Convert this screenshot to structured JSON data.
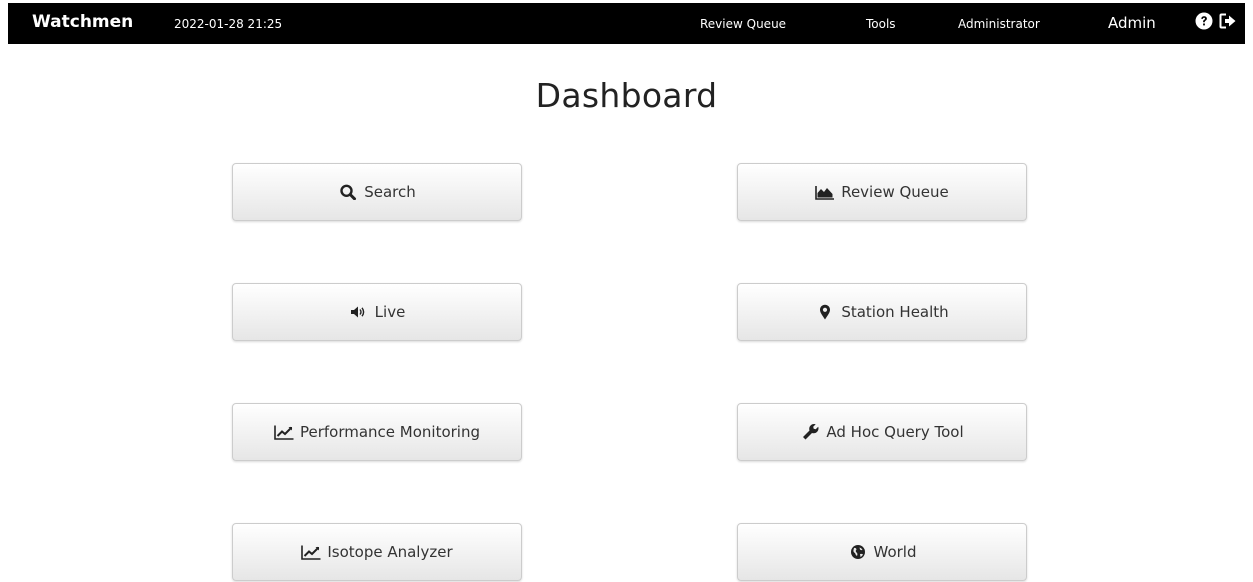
{
  "navbar": {
    "brand": "Watchmen",
    "datetime": "2022-01-28 21:25",
    "links": [
      {
        "label": "Review Queue"
      },
      {
        "label": "Tools"
      },
      {
        "label": "Administrator"
      }
    ],
    "user": "Admin",
    "icons": [
      "help-circle-icon",
      "sign-out-icon"
    ]
  },
  "page": {
    "title": "Dashboard"
  },
  "tiles": [
    {
      "label": "Search",
      "icon": "search-icon"
    },
    {
      "label": "Review Queue",
      "icon": "area-chart-icon"
    },
    {
      "label": "Live",
      "icon": "volume-icon"
    },
    {
      "label": "Station Health",
      "icon": "map-marker-icon"
    },
    {
      "label": "Performance Monitoring",
      "icon": "line-chart-icon"
    },
    {
      "label": "Ad Hoc Query Tool",
      "icon": "wrench-icon"
    },
    {
      "label": "Isotope Analyzer",
      "icon": "line-chart-icon"
    },
    {
      "label": "World",
      "icon": "globe-icon"
    }
  ],
  "colors": {
    "navbar_bg": "#000000",
    "navbar_text": "#ffffff",
    "tile_border": "#cccccc",
    "tile_text": "#333333"
  }
}
